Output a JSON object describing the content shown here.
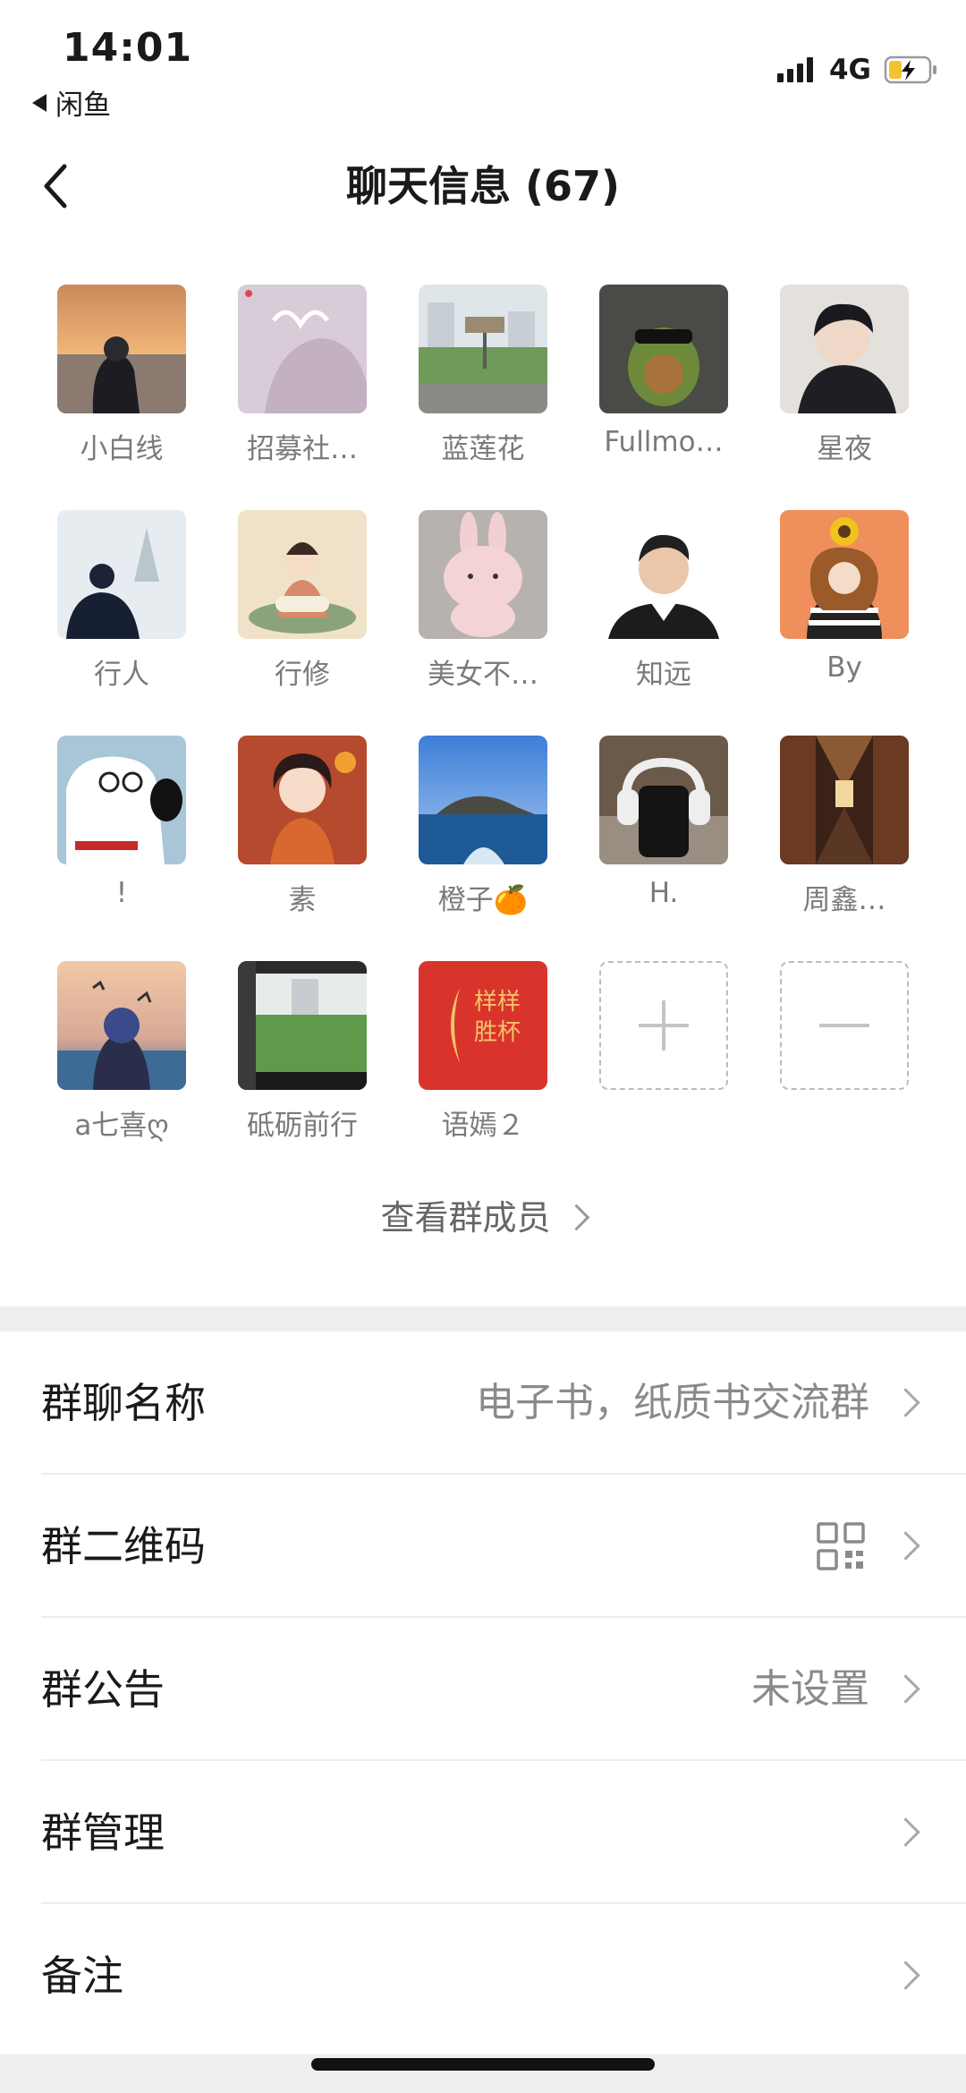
{
  "status_bar": {
    "time": "14:01",
    "back_app": "闲鱼",
    "network": "4G",
    "icons": [
      "signal-icon",
      "battery-charging-icon"
    ]
  },
  "nav": {
    "title": "聊天信息 (67)",
    "back_icon": "back-chevron-icon"
  },
  "members": [
    {
      "name": "小白线"
    },
    {
      "name": "招募社…"
    },
    {
      "name": "蓝莲花"
    },
    {
      "name": "Fullmo…"
    },
    {
      "name": "星夜"
    },
    {
      "name": "行人"
    },
    {
      "name": "行修"
    },
    {
      "name": "美女不…"
    },
    {
      "name": "知远"
    },
    {
      "name": "By"
    },
    {
      "name": "!"
    },
    {
      "name": "素"
    },
    {
      "name": "橙子🍊"
    },
    {
      "name": "H."
    },
    {
      "name": "周鑫…"
    },
    {
      "name": "a七喜ღ"
    },
    {
      "name": "砥砺前行"
    },
    {
      "name": "语嫣２"
    }
  ],
  "member_actions": {
    "add_icon": "plus-icon",
    "remove_icon": "minus-icon"
  },
  "avatar_texts": {
    "lunar_badge": "样样胜杯"
  },
  "view_members": "查看群成员",
  "settings": {
    "group_name": {
      "label": "群聊名称",
      "value": "电子书，纸质书交流群"
    },
    "qr_code": {
      "label": "群二维码",
      "icon": "qr-code-icon"
    },
    "announcement": {
      "label": "群公告",
      "value": "未设置"
    },
    "management": {
      "label": "群管理"
    },
    "remark": {
      "label": "备注"
    }
  },
  "colors": {
    "section_gap": "#efefef",
    "secondary_text": "#8a8a8a",
    "badge_red": "#d9342b",
    "badge_gold": "#f3c46b"
  }
}
